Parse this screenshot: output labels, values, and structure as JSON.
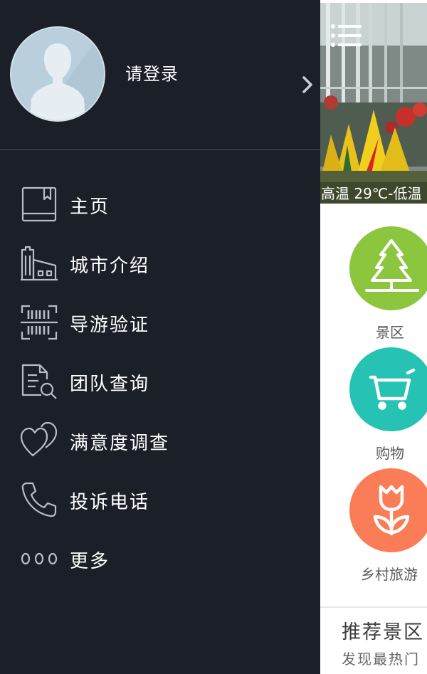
{
  "profile": {
    "login_text": "请登录"
  },
  "menu": [
    {
      "label": "主页",
      "icon": "book-icon"
    },
    {
      "label": "城市介绍",
      "icon": "city-buildings-icon"
    },
    {
      "label": "导游验证",
      "icon": "barcode-scan-icon"
    },
    {
      "label": "团队查询",
      "icon": "document-search-icon"
    },
    {
      "label": "满意度调查",
      "icon": "hearts-icon"
    },
    {
      "label": "投诉电话",
      "icon": "phone-icon"
    },
    {
      "label": "更多",
      "icon": "more-dots-icon"
    }
  ],
  "banner": {
    "weather": "高温 29℃-低温"
  },
  "categories": [
    {
      "label": "景区",
      "icon": "tree-icon",
      "color": "#8cc63e"
    },
    {
      "label": "购物",
      "icon": "shopping-cart-icon",
      "color": "#26c2b4"
    },
    {
      "label": "乡村旅游",
      "icon": "tulip-icon",
      "color": "#fb7d57"
    }
  ],
  "recommend": {
    "title": "推荐景区",
    "subtitle": "发现最热门"
  },
  "colors": {
    "drawer_bg": "#1b1f27",
    "text_light": "#ffffff",
    "icon_stroke": "#b8bec7"
  }
}
